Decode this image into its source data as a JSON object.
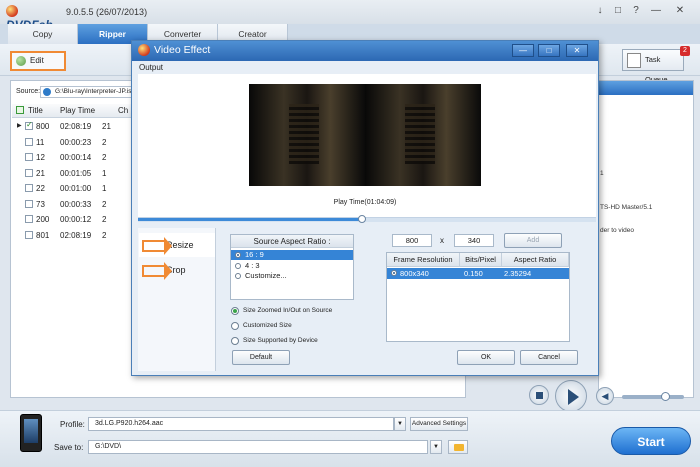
{
  "app": {
    "title": "DVDFab",
    "version": "9.0.5.5 (26/07/2013)",
    "window_controls": [
      "↓",
      "□",
      "?",
      "—",
      "✕"
    ]
  },
  "tabs": [
    {
      "label": "Copy",
      "active": false
    },
    {
      "label": "Ripper",
      "active": true
    },
    {
      "label": "Converter",
      "active": false
    },
    {
      "label": "Creator",
      "active": false
    }
  ],
  "toolbar": {
    "edit_label": "Edit",
    "task_queue_label": "Task Queue",
    "task_queue_count": "2"
  },
  "source": {
    "label": "Source:",
    "value": "G:\\Blu-ray\\Interpreter-JP.iso"
  },
  "title_list": {
    "headers": [
      "Title",
      "Play Time",
      "Ch"
    ],
    "rows": [
      {
        "title": "800",
        "time": "02:08:19",
        "ch": "21",
        "checked": true,
        "current": true
      },
      {
        "title": "11",
        "time": "00:00:23",
        "ch": "2",
        "checked": false,
        "current": false
      },
      {
        "title": "12",
        "time": "00:00:14",
        "ch": "2",
        "checked": false,
        "current": false
      },
      {
        "title": "21",
        "time": "00:01:05",
        "ch": "1",
        "checked": false,
        "current": false
      },
      {
        "title": "22",
        "time": "00:01:00",
        "ch": "1",
        "checked": false,
        "current": false
      },
      {
        "title": "73",
        "time": "00:00:33",
        "ch": "2",
        "checked": false,
        "current": false
      },
      {
        "title": "200",
        "time": "00:00:12",
        "ch": "2",
        "checked": false,
        "current": false
      },
      {
        "title": "801",
        "time": "02:08:19",
        "ch": "2",
        "checked": false,
        "current": false
      }
    ]
  },
  "right_panel": {
    "lines": [
      "1",
      "TS-HD Master/5.1",
      "der to video"
    ]
  },
  "dialog": {
    "title": "Video Effect",
    "output_label": "Output",
    "play_time": "Play Time(01:04:09)",
    "play_progress": 0.49,
    "side_tabs": [
      {
        "label": "Resize",
        "selected": true
      },
      {
        "label": "Crop",
        "selected": false
      }
    ],
    "source_aspect_ratio": {
      "title": "Source Aspect Ratio :",
      "options": [
        {
          "label": "16 : 9",
          "selected": true
        },
        {
          "label": "4 : 3",
          "selected": false
        },
        {
          "label": "Customize...",
          "selected": false
        }
      ]
    },
    "size_options": [
      {
        "label": "Size Zoomed In/Out on Source",
        "selected": true
      },
      {
        "label": "Customized Size",
        "selected": false
      },
      {
        "label": "Size Supported by Device",
        "selected": false
      }
    ],
    "width": "800",
    "x_sep": "x",
    "height": "340",
    "add_label": "Add",
    "table": {
      "headers": [
        "Frame Resolution",
        "Bits/Pixel",
        "Aspect Ratio"
      ],
      "rows": [
        {
          "resolution": "800x340",
          "bits": "0.150",
          "aspect": "2.35294",
          "selected": true
        }
      ]
    },
    "default_label": "Default",
    "ok_label": "OK",
    "cancel_label": "Cancel"
  },
  "bottom": {
    "profile_label": "Profile:",
    "profile_value": "3d.LG.P920.h264.aac",
    "advanced_label": "Advanced Settings",
    "saveto_label": "Save to:",
    "saveto_value": "G:\\DVD\\",
    "start_label": "Start"
  },
  "player": {
    "volume_level": 0.7
  }
}
